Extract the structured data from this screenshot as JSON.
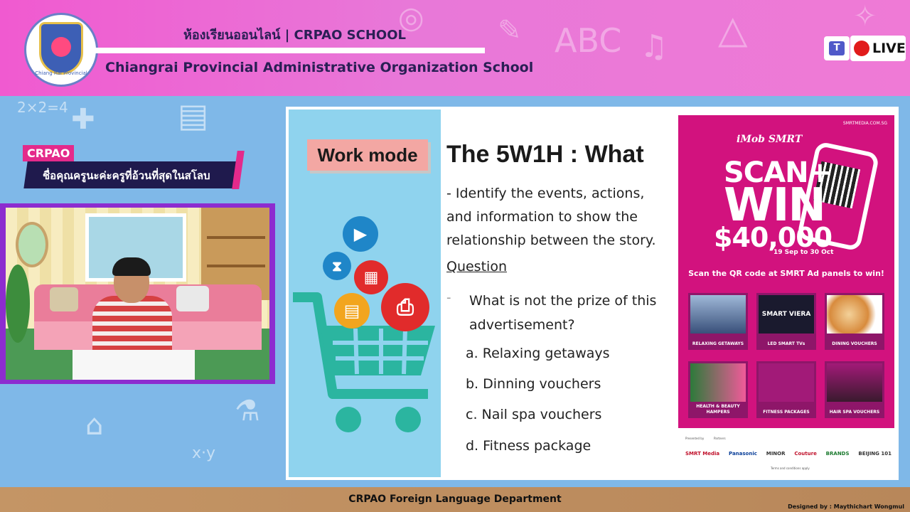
{
  "header": {
    "title_th": "ห้องเรียนออนไลน์ | CRPAO SCHOOL",
    "title_en": "Chiangrai Provincial Administrative Organization School",
    "logo_text": "Chiang Rai Provincial",
    "live_label": "LIVE",
    "teams_glyph": "T"
  },
  "presenter": {
    "tag": "CRPAO",
    "name": "ชื่อคุณครูนะค่ะครูที่อ้วนที่สุดในสโลบ"
  },
  "slide": {
    "work_mode": "Work mode",
    "heading": "The 5W1H : What",
    "description": "- Identify the events, actions, and information to show the relationship between the story.",
    "question_label": "Question",
    "question_dash": "-",
    "question": "What is not the prize of this advertisement?",
    "options": [
      "a. Relaxing getaways",
      "b. Dinning vouchers",
      "c. Nail spa vouchers",
      "d. Fitness package"
    ]
  },
  "ad": {
    "site": "SMRTMEDIA.COM.SG",
    "brand": "iMob SMRT",
    "scan": "SCAN+",
    "win": "WIN",
    "amount": "$40,000",
    "dates": "19 Sep to 30 Oct",
    "scan_instruction": "Scan the QR code at SMRT Ad panels to win!",
    "tiles": [
      "RELAXING GETAWAYS",
      "LED SMART TVs",
      "DINING VOUCHERS",
      "HEALTH & BEAUTY HAMPERS",
      "FITNESS PACKAGES",
      "HAIR SPA VOUCHERS"
    ],
    "tv_text": "SMART VIERA",
    "tv_brand": "Panasonic",
    "partners": [
      "SMRT Media",
      "Panasonic",
      "",
      "MINOR",
      "Couture",
      "BRANDS",
      "BEIJING 101",
      ""
    ],
    "presented_by": "Presented by",
    "partners_label": "Partners",
    "terms": "Terms and conditions apply"
  },
  "footer": {
    "department": "CRPAO Foreign Language Department",
    "designed_by": "Designed by : Maythichart Wongmul"
  },
  "colors": {
    "header_pink": "#f05ad0",
    "navy": "#1f1a4d",
    "accent_pink": "#e42a8b",
    "slide_blue": "#8fd3ee",
    "ad_magenta": "#d2127e",
    "cart_teal": "#2bb5a0"
  }
}
